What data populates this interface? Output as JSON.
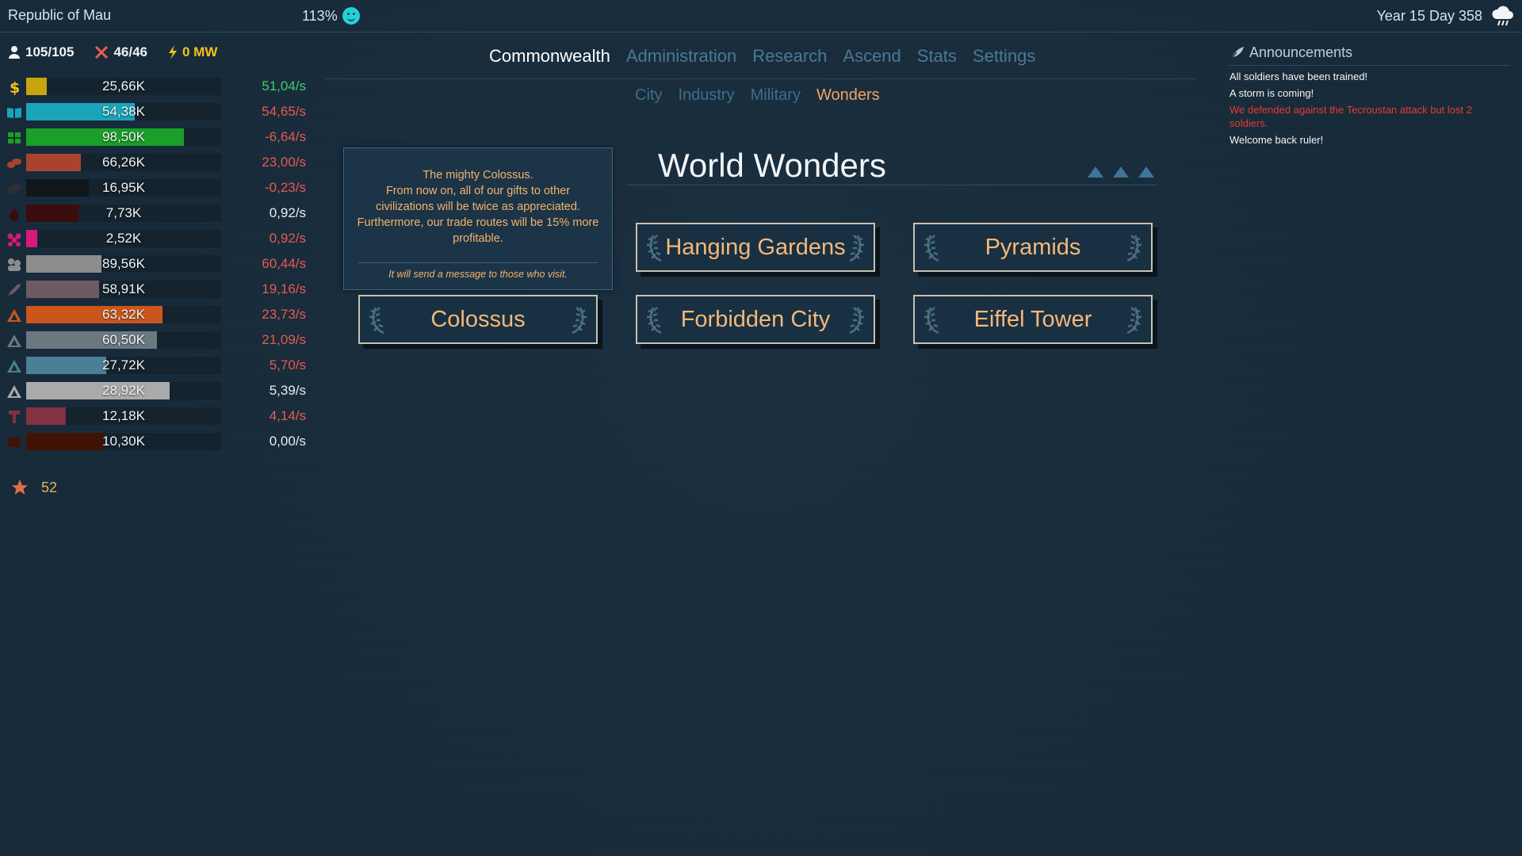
{
  "topbar": {
    "government": "Republic of Mau",
    "happiness": "113%",
    "date": "Year 15 Day 358"
  },
  "population": {
    "current": "105/105",
    "soldiers": "46/46",
    "power": "0 MW"
  },
  "resources": [
    {
      "icon": "money-icon",
      "value": "25,66K",
      "rate": "51,04/s",
      "trend": "pos",
      "fill": 0.105,
      "color": "#c9a40f"
    },
    {
      "icon": "book-icon",
      "value": "54,38K",
      "rate": "54,65/s",
      "trend": "neg",
      "fill": 0.555,
      "color": "#1aa4ba"
    },
    {
      "icon": "food-icon",
      "value": "98,50K",
      "rate": "-6,64/s",
      "trend": "neg",
      "fill": 0.81,
      "color": "#1aa028"
    },
    {
      "icon": "wood-icon",
      "value": "66,26K",
      "rate": "23,00/s",
      "trend": "neg",
      "fill": 0.28,
      "color": "#a8432f"
    },
    {
      "icon": "stone-icon",
      "value": "16,95K",
      "rate": "-0,23/s",
      "trend": "neg",
      "fill": 0.32,
      "color": "#0f171c"
    },
    {
      "icon": "oil-icon",
      "value": "7,73K",
      "rate": "0,92/s",
      "trend": "neu",
      "fill": 0.27,
      "color": "#3a0c0c"
    },
    {
      "icon": "gem-icon",
      "value": "2,52K",
      "rate": "0,92/s",
      "trend": "neg",
      "fill": 0.055,
      "color": "#d6197a"
    },
    {
      "icon": "people-icon",
      "value": "89,56K",
      "rate": "60,44/s",
      "trend": "neg",
      "fill": 0.385,
      "color": "#8d8d8d"
    },
    {
      "icon": "rocket-icon",
      "value": "58,91K",
      "rate": "19,16/s",
      "trend": "neg",
      "fill": 0.375,
      "color": "#6e5a62"
    },
    {
      "icon": "ore-icon",
      "value": "63,32K",
      "rate": "23,73/s",
      "trend": "neg",
      "fill": 0.7,
      "color": "#c9571b"
    },
    {
      "icon": "ore-icon",
      "value": "60,50K",
      "rate": "21,09/s",
      "trend": "neg",
      "fill": 0.67,
      "color": "#6c7880"
    },
    {
      "icon": "ore-icon",
      "value": "27,72K",
      "rate": "5,70/s",
      "trend": "neg",
      "fill": 0.41,
      "color": "#4a7f95"
    },
    {
      "icon": "ore-icon",
      "value": "28,92K",
      "rate": "5,39/s",
      "trend": "neu",
      "fill": 0.735,
      "color": "#aaaaaa"
    },
    {
      "icon": "tool-icon",
      "value": "12,18K",
      "rate": "4,14/s",
      "trend": "neg",
      "fill": 0.205,
      "color": "#843140"
    },
    {
      "icon": "brick-icon",
      "value": "10,30K",
      "rate": "0,00/s",
      "trend": "neu",
      "fill": 0.4,
      "color": "#3f1407"
    }
  ],
  "prestige": "52",
  "nav": {
    "main": [
      "Commonwealth",
      "Administration",
      "Research",
      "Ascend",
      "Stats",
      "Settings"
    ],
    "main_active": 0,
    "sub": [
      "City",
      "Industry",
      "Military",
      "Wonders"
    ],
    "sub_active": 3
  },
  "wonders": {
    "title": "World Wonders",
    "tooltip": {
      "lines": [
        "The mighty Colossus.",
        "From now on, all of our gifts to other civilizations will be twice as appreciated.",
        "Furthermore, our trade routes will be 15% more profitable."
      ],
      "note": "It will send a message to those who visit."
    },
    "buttons": {
      "hanging_gardens": "Hanging Gardens",
      "pyramids": "Pyramids",
      "colossus": "Colossus",
      "forbidden_city": "Forbidden City",
      "eiffel_tower": "Eiffel Tower"
    }
  },
  "announcements": {
    "title": "Announcements",
    "items": [
      {
        "text": "All soldiers have been trained!",
        "alert": false
      },
      {
        "text": "A storm is coming!",
        "alert": false
      },
      {
        "text": "We defended against the Tecroustan attack but lost 2 soldiers.",
        "alert": true
      },
      {
        "text": "Welcome back ruler!",
        "alert": false
      }
    ]
  }
}
